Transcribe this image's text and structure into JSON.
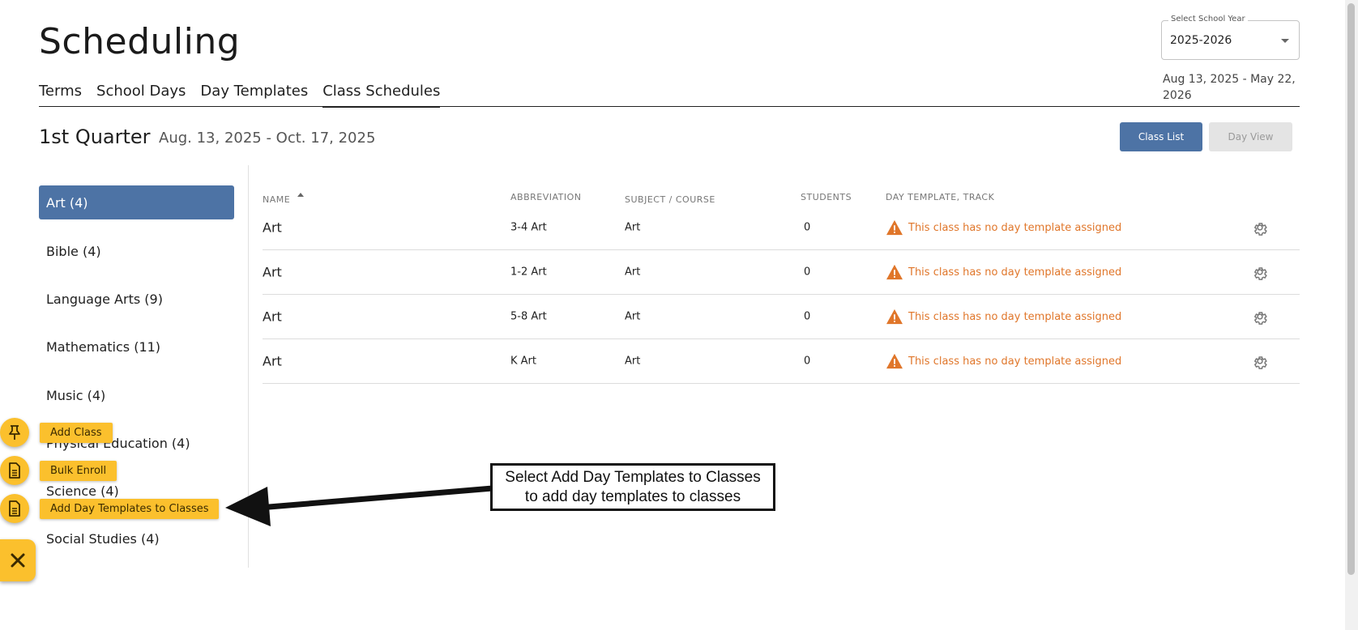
{
  "page": {
    "title": "Scheduling"
  },
  "tabs": [
    {
      "label": "Terms",
      "active": false
    },
    {
      "label": "School Days",
      "active": false
    },
    {
      "label": "Day Templates",
      "active": false
    },
    {
      "label": "Class Schedules",
      "active": true
    }
  ],
  "school_year": {
    "legend": "Select School Year",
    "value": "2025-2026",
    "range": "Aug 13, 2025 - May 22, 2026"
  },
  "term": {
    "name": "1st Quarter",
    "dates": "Aug. 13, 2025 - Oct. 17, 2025"
  },
  "view_buttons": {
    "class_list": "Class List",
    "day_view": "Day View"
  },
  "sidebar": {
    "items": [
      {
        "label": "Art (4)",
        "active": true
      },
      {
        "label": "Bible (4)",
        "active": false
      },
      {
        "label": "Language Arts (9)",
        "active": false
      },
      {
        "label": "Mathematics (11)",
        "active": false
      },
      {
        "label": "Music (4)",
        "active": false
      },
      {
        "label": "Physical Education (4)",
        "active": false
      },
      {
        "label": "Science (4)",
        "active": false
      },
      {
        "label": "Social Studies (4)",
        "active": false
      }
    ]
  },
  "table": {
    "headers": {
      "name": "NAME",
      "abbreviation": "ABBREVIATION",
      "subject": "SUBJECT / COURSE",
      "students": "STUDENTS",
      "day_template": "DAY TEMPLATE, TRACK"
    },
    "rows": [
      {
        "name": "Art",
        "abbreviation": "3-4 Art",
        "subject": "Art",
        "students": "0",
        "warning": "This class has no day template assigned"
      },
      {
        "name": "Art",
        "abbreviation": "1-2 Art",
        "subject": "Art",
        "students": "0",
        "warning": "This class has no day template assigned"
      },
      {
        "name": "Art",
        "abbreviation": "5-8 Art",
        "subject": "Art",
        "students": "0",
        "warning": "This class has no day template assigned"
      },
      {
        "name": "Art",
        "abbreviation": "K Art",
        "subject": "Art",
        "students": "0",
        "warning": "This class has no day template assigned"
      }
    ]
  },
  "fab_menu": {
    "add_class": "Add Class",
    "bulk_enroll": "Bulk Enroll",
    "add_day_templates": "Add Day Templates to Classes"
  },
  "callout": {
    "line1": "Select Add Day Templates to Classes",
    "line2": "to add day templates to classes"
  },
  "colors": {
    "primary": "#4d73a5",
    "warning": "#e0762a",
    "fab": "#fbc02d"
  }
}
